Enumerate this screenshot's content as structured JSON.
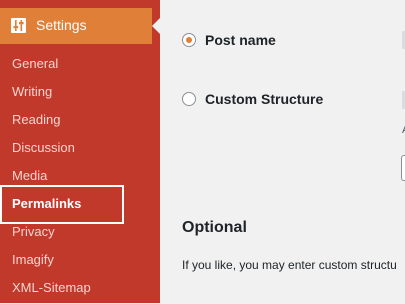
{
  "sidebar": {
    "section_title": "Settings",
    "section_icon": "sliders-icon",
    "items": [
      {
        "label": "General"
      },
      {
        "label": "Writing"
      },
      {
        "label": "Reading"
      },
      {
        "label": "Discussion"
      },
      {
        "label": "Media"
      },
      {
        "label": "Permalinks"
      },
      {
        "label": "Privacy"
      },
      {
        "label": "Imagify"
      },
      {
        "label": "XML-Sitemap"
      }
    ],
    "active_item": "Permalinks"
  },
  "main": {
    "options": [
      {
        "label": "Post name",
        "checked": true
      },
      {
        "label": "Custom Structure",
        "checked": false
      }
    ],
    "truncated_letter": "A",
    "optional_heading": "Optional",
    "optional_description": "If you like, you may enter custom structu"
  },
  "colors": {
    "sidebar_bg": "#c0392b",
    "accent": "#df7f38",
    "content_bg": "#f1f1f1"
  }
}
